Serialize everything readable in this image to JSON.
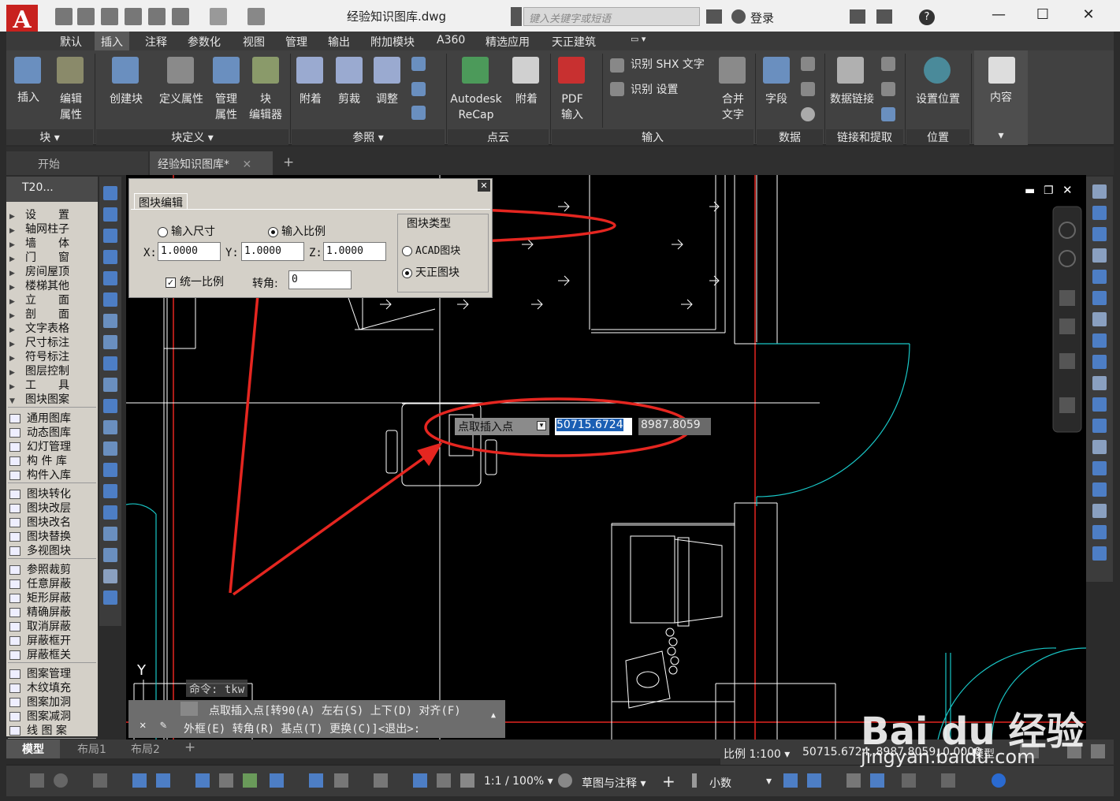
{
  "window": {
    "title": "经验知识图库.dwg",
    "search_placeholder": "键入关键字或短语",
    "login": "登录",
    "logo": "A"
  },
  "menu": {
    "tabs": [
      "默认",
      "插入",
      "注释",
      "参数化",
      "视图",
      "管理",
      "输出",
      "附加模块",
      "A360",
      "精选应用",
      "天正建筑"
    ]
  },
  "ribbon": {
    "insert": "插入",
    "edit_attr_1": "编辑",
    "edit_attr_2": "属性",
    "create_block": "创建块",
    "define_attr": "定义属性",
    "manage_attr_1": "管理",
    "manage_attr_2": "属性",
    "block_editor_1": "块",
    "block_editor_2": "编辑器",
    "attach": "附着",
    "clip": "剪裁",
    "adjust": "调整",
    "recap_1": "Autodesk",
    "recap_2": "ReCap",
    "attach2": "附着",
    "pdf_1": "PDF",
    "pdf_2": "输入",
    "shx_recognize": "识别 SHX 文字",
    "shx_settings": "识别 设置",
    "merge_text_1": "合并",
    "merge_text_2": "文字",
    "field": "字段",
    "data_link": "数据链接",
    "set_location": "设置位置",
    "content": "内容",
    "panels": {
      "block": "块",
      "block_def": "块定义",
      "reference": "参照",
      "pointcloud": "点云",
      "import": "输入",
      "data": "数据",
      "linking": "链接和提取",
      "location": "位置"
    }
  },
  "doc_tabs": {
    "start": "开始",
    "current": "经验知识图库*",
    "add": "+"
  },
  "palette": {
    "title": "T20...",
    "group1": [
      "设　　置",
      "轴网柱子",
      "墙　　体",
      "门　　窗",
      "房间屋顶",
      "楼梯其他",
      "立　　面",
      "剖　　面",
      "文字表格",
      "尺寸标注",
      "符号标注",
      "图层控制",
      "工　　具",
      "图块图案"
    ],
    "group2": [
      "通用图库",
      "动态图库",
      "幻灯管理",
      "构 件 库",
      "构件入库"
    ],
    "group3": [
      "图块转化",
      "图块改层",
      "图块改名",
      "图块替换",
      "多视图块"
    ],
    "group4": [
      "参照裁剪",
      "任意屏蔽",
      "矩形屏蔽",
      "精确屏蔽",
      "取消屏蔽",
      "屏蔽框开",
      "屏蔽框关"
    ],
    "group5": [
      "图案管理",
      "木纹填充",
      "图案加洞",
      "图案减洞",
      "线 图 案"
    ]
  },
  "dialog": {
    "tab": "图块编辑",
    "opt_size": "输入尺寸",
    "opt_scale": "输入比例",
    "x_label": "X:",
    "y_label": "Y:",
    "z_label": "Z:",
    "x": "1.0000",
    "y": "1.0000",
    "z": "1.0000",
    "uniform": "统一比例",
    "rotate_label": "转角:",
    "rotate": "0",
    "type_title": "图块类型",
    "type_acad": "ACAD图块",
    "type_tz": "天正图块"
  },
  "dynamic_input": {
    "prompt": "点取插入点",
    "x": "50715.6724",
    "y": "8987.8059"
  },
  "command": {
    "history": "命令: tkw",
    "line1": "点取插入点[转90(A) 左右(S) 上下(D) 对齐(F)",
    "line2": "外框(E) 转角(R) 基点(T) 更换(C)]<退出>:"
  },
  "layout_tabs": [
    "模型",
    "布局1",
    "布局2",
    "+"
  ],
  "status": {
    "scale": "比例 1:100",
    "coords": "50715.6724, 8987.8059, 0.0000",
    "model": "模型",
    "annot_scale": "1:1 / 100%",
    "workspace": "草图与注释",
    "units": "小数"
  },
  "axis_label": "Y",
  "watermark": {
    "brand": "Bai du 经验",
    "url": "jingyan.baidu.com"
  },
  "colors": {
    "accent_red": "#e52620",
    "cyan_lines": "#19c7c7",
    "ribbon_bg": "#414141"
  }
}
